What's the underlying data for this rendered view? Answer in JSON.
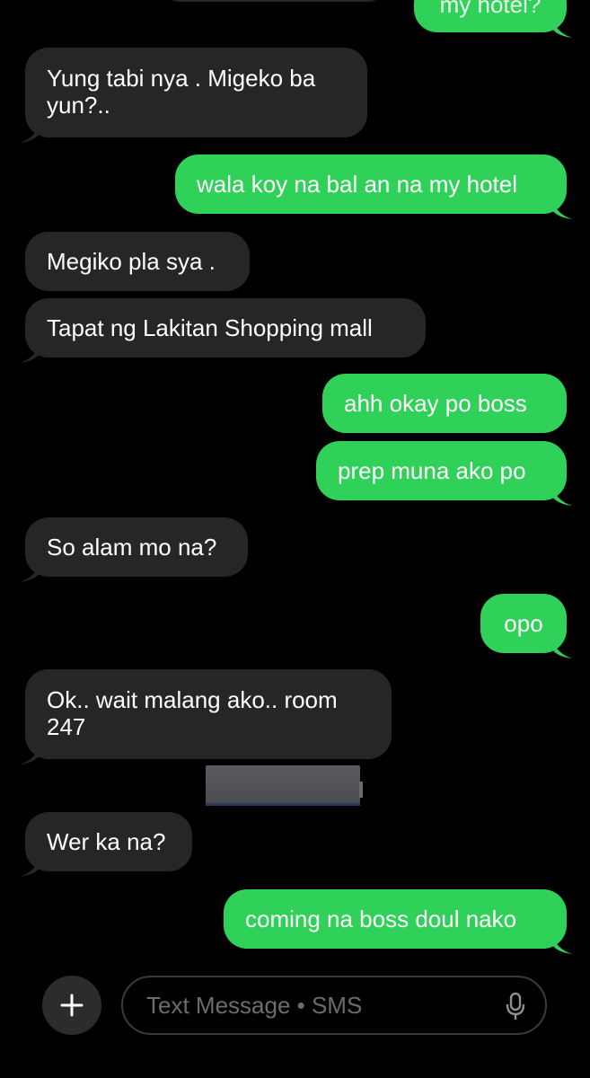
{
  "messages": [
    {
      "dir": "out",
      "text": "my hotel?"
    },
    {
      "dir": "in",
      "lines": [
        "Yung tabi nya . Migeko ba",
        "yun?.."
      ]
    },
    {
      "dir": "out",
      "text": "wala koy na bal an na my hotel"
    },
    {
      "dir": "in",
      "text": "Megiko pla sya ."
    },
    {
      "dir": "in",
      "text": "Tapat ng Lakitan Shopping mall"
    },
    {
      "dir": "out",
      "text": "ahh okay po boss"
    },
    {
      "dir": "out",
      "text": "prep muna ako po"
    },
    {
      "dir": "in",
      "text": "So alam mo na?"
    },
    {
      "dir": "out",
      "text": "opo"
    },
    {
      "dir": "in",
      "lines": [
        "Ok.. wait malang ako.. room",
        "247"
      ]
    },
    {
      "dir": "in",
      "text": "Wer ka na?"
    },
    {
      "dir": "out",
      "text": "coming na boss doul nako"
    }
  ],
  "composer": {
    "placeholder": "Text Message • SMS",
    "add_icon": "plus-icon",
    "mic_icon": "microphone-icon"
  },
  "colors": {
    "background": "#000000",
    "incoming_bubble": "#262628",
    "outgoing_bubble": "#30d158"
  }
}
